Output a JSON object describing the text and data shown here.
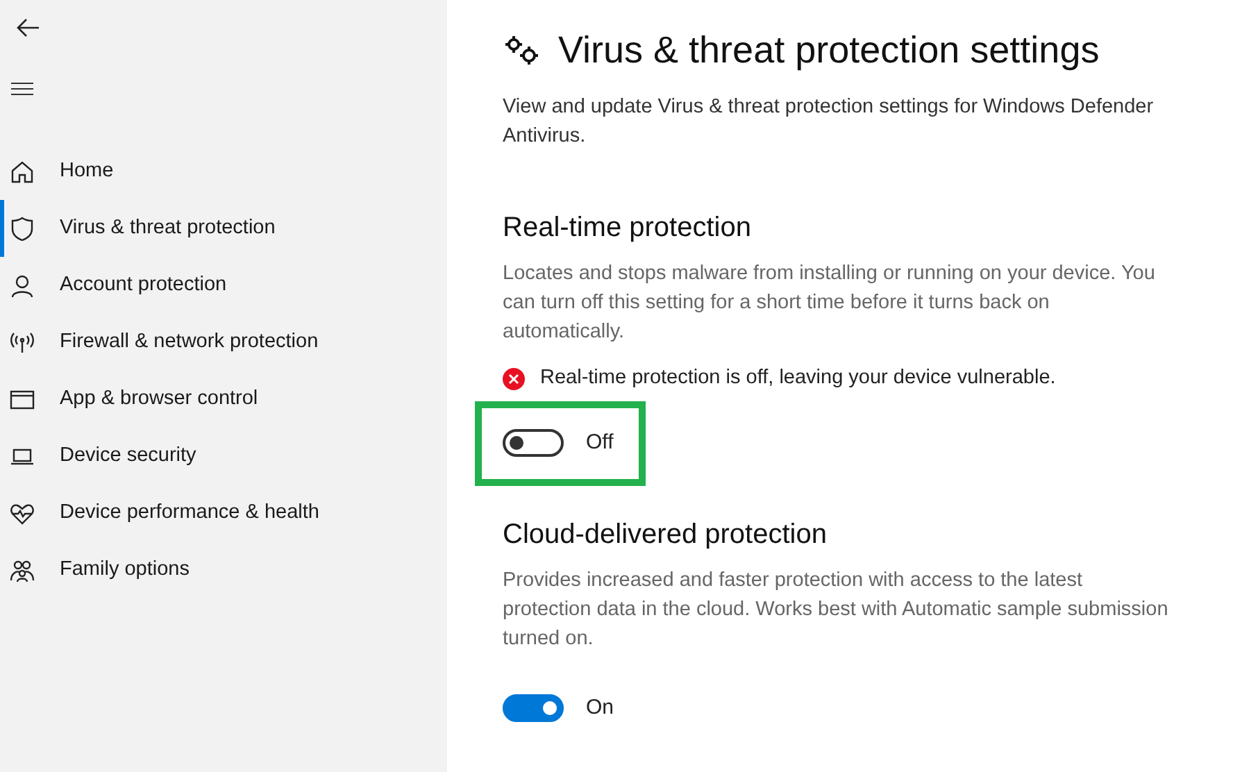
{
  "sidebar": {
    "items": [
      {
        "label": "Home",
        "selected": false
      },
      {
        "label": "Virus & threat protection",
        "selected": true
      },
      {
        "label": "Account protection",
        "selected": false
      },
      {
        "label": "Firewall & network protection",
        "selected": false
      },
      {
        "label": "App & browser control",
        "selected": false
      },
      {
        "label": "Device security",
        "selected": false
      },
      {
        "label": "Device performance & health",
        "selected": false
      },
      {
        "label": "Family options",
        "selected": false
      }
    ]
  },
  "page": {
    "title": "Virus & threat protection settings",
    "description": "View and update Virus & threat protection settings for Windows Defender Antivirus."
  },
  "sections": [
    {
      "heading": "Real-time protection",
      "description": "Locates and stops malware from installing or running on your device. You can turn off this setting for a short time before it turns back on automatically.",
      "warning": "Real-time protection is off, leaving your device vulnerable.",
      "toggle": {
        "on": false,
        "label": "Off"
      },
      "highlighted": true
    },
    {
      "heading": "Cloud-delivered protection",
      "description": "Provides increased and faster protection with access to the latest protection data in the cloud.  Works best with Automatic sample submission turned on.",
      "toggle": {
        "on": true,
        "label": "On"
      },
      "highlighted": false
    }
  ]
}
